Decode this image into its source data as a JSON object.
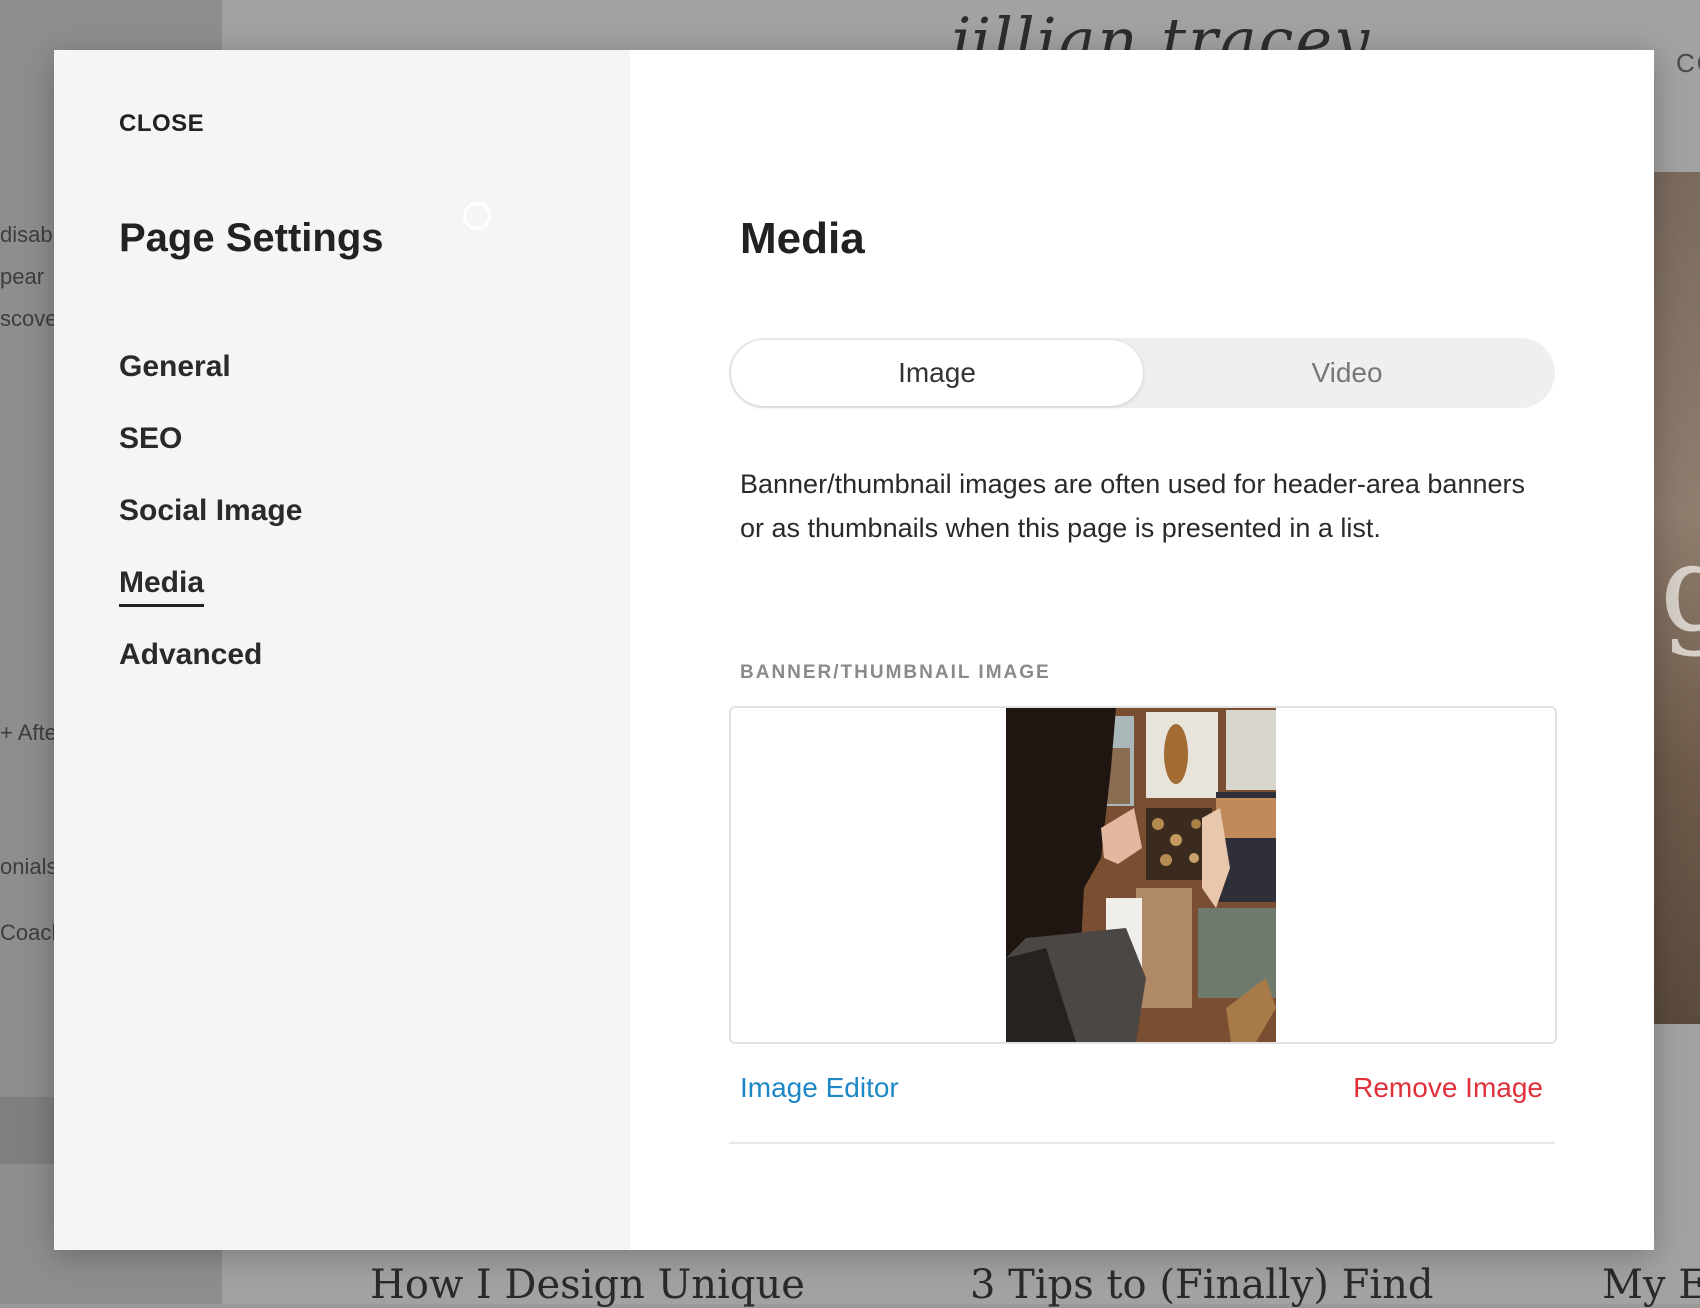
{
  "background": {
    "logo": "jillian tracey",
    "nav_fragment": "CO",
    "hero_letter": "g",
    "side_text": [
      "disab",
      "pear",
      "scove",
      "+ Afte",
      "onials",
      "Coach"
    ],
    "card_titles": [
      "How I Design Unique",
      "3 Tips to (Finally) Find",
      "My E"
    ]
  },
  "modal": {
    "close_label": "CLOSE",
    "sidebar_title": "Page Settings",
    "nav": [
      {
        "label": "General"
      },
      {
        "label": "SEO"
      },
      {
        "label": "Social Image"
      },
      {
        "label": "Media"
      },
      {
        "label": "Advanced"
      }
    ],
    "active_nav": "Media",
    "panel": {
      "title": "Media",
      "tabs": [
        {
          "label": "Image"
        },
        {
          "label": "Video"
        }
      ],
      "selected_tab": "Image",
      "description": "Banner/thumbnail images are often used for header-area banners or as thumbnails when this page is presented in a list.",
      "field_label": "BANNER/THUMBNAIL IMAGE",
      "image_editor_label": "Image Editor",
      "remove_image_label": "Remove Image"
    }
  },
  "colors": {
    "link_blue": "#1e88c7",
    "remove_red": "#e0303a",
    "sidebar_bg": "#f5f5f5"
  }
}
